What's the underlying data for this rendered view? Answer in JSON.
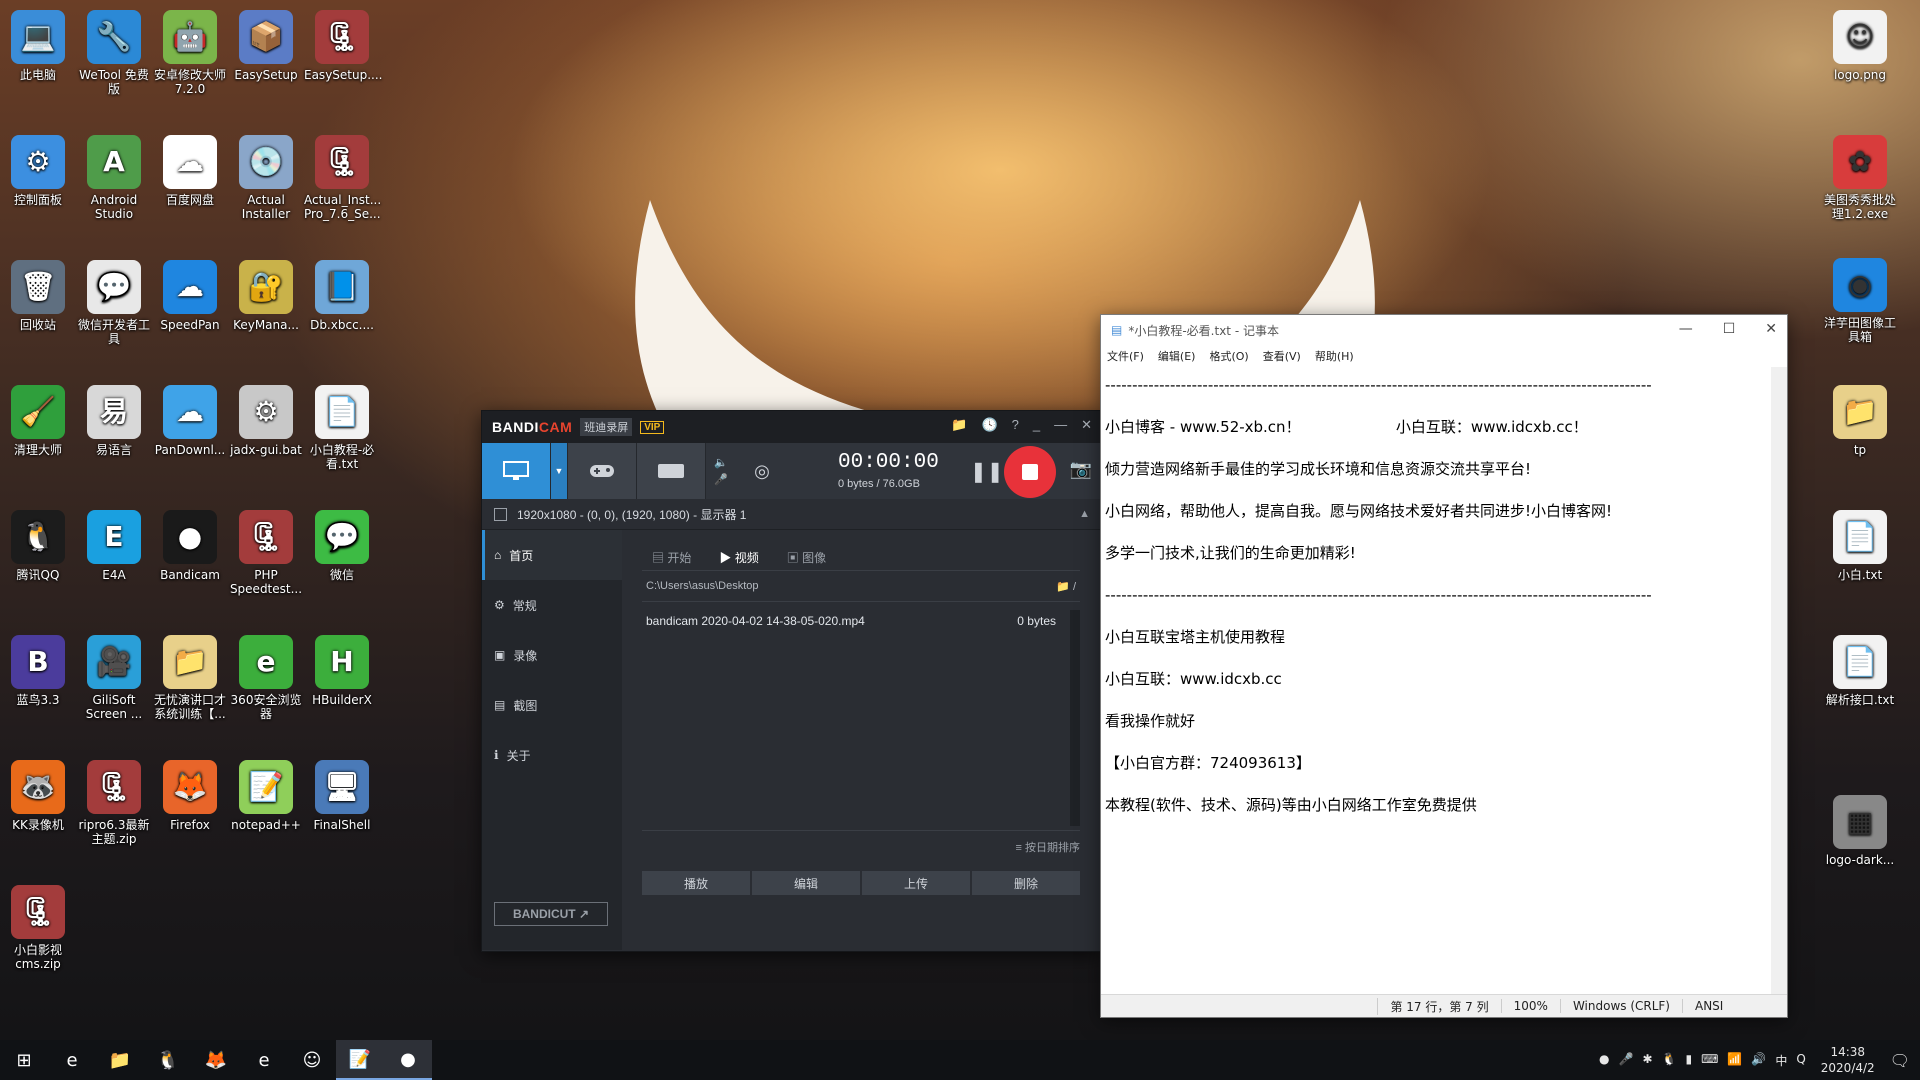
{
  "desktop": {
    "icons": [
      {
        "label": "此电脑",
        "color": "#3a8dd8",
        "glyph": "💻"
      },
      {
        "label": "WeTool 免费版",
        "color": "#2b89d6",
        "glyph": "🔧"
      },
      {
        "label": "安卓修改大师7.2.0",
        "color": "#7bb54a",
        "glyph": "🤖"
      },
      {
        "label": "EasySetup",
        "color": "#5b7cc6",
        "glyph": "📦"
      },
      {
        "label": "EasySetup....",
        "color": "#a33c3c",
        "glyph": "🗜"
      },
      {
        "label": "控制面板",
        "color": "#3c8fe0",
        "glyph": "⚙"
      },
      {
        "label": "Android Studio",
        "color": "#4f9c4a",
        "glyph": "A"
      },
      {
        "label": "百度网盘",
        "color": "#ffffff",
        "glyph": "☁"
      },
      {
        "label": "Actual Installer",
        "color": "#8aa6c9",
        "glyph": "💿"
      },
      {
        "label": "Actual_Inst... Pro_7.6_Se...",
        "color": "#a33c3c",
        "glyph": "🗜"
      },
      {
        "label": "回收站",
        "color": "#5f6f80",
        "glyph": "🗑"
      },
      {
        "label": "微信开发者工具",
        "color": "#e8e8e8",
        "glyph": "💬"
      },
      {
        "label": "SpeedPan",
        "color": "#1f86e0",
        "glyph": "☁"
      },
      {
        "label": "KeyMana...",
        "color": "#c9b24a",
        "glyph": "🔐"
      },
      {
        "label": "Db.xbcc....",
        "color": "#6fa7d8",
        "glyph": "📘"
      },
      {
        "label": "清理大师",
        "color": "#2f9f3c",
        "glyph": "🧹"
      },
      {
        "label": "易语言",
        "color": "#d8d8d8",
        "glyph": "易"
      },
      {
        "label": "PanDownl...",
        "color": "#3fa3e8",
        "glyph": "☁"
      },
      {
        "label": "jadx-gui.bat",
        "color": "#c8c8c8",
        "glyph": "⚙"
      },
      {
        "label": "小白教程-必看.txt",
        "color": "#f2f2f2",
        "glyph": "📄"
      },
      {
        "label": "腾讯QQ",
        "color": "#1c1c1c",
        "glyph": "🐧"
      },
      {
        "label": "E4A",
        "color": "#1aa0e0",
        "glyph": "E"
      },
      {
        "label": "Bandicam",
        "color": "#1a1a1a",
        "glyph": "●"
      },
      {
        "label": "PHP Speedtest...",
        "color": "#a33c3c",
        "glyph": "🗜"
      },
      {
        "label": "微信",
        "color": "#3dbb44",
        "glyph": "💬"
      },
      {
        "label": "蓝鸟3.3",
        "color": "#4b3c9c",
        "glyph": "B"
      },
      {
        "label": "GiliSoft Screen ...",
        "color": "#2a9fd8",
        "glyph": "🎥"
      },
      {
        "label": "无忧演讲口才系统训练【...",
        "color": "#e8d08a",
        "glyph": "📁"
      },
      {
        "label": "360安全浏览器",
        "color": "#3cae3c",
        "glyph": "e"
      },
      {
        "label": "HBuilderX",
        "color": "#3cae3c",
        "glyph": "H"
      },
      {
        "label": "KK录像机",
        "color": "#e86a1a",
        "glyph": "🦝"
      },
      {
        "label": "ripro6.3最新主题.zip",
        "color": "#a33c3c",
        "glyph": "🗜"
      },
      {
        "label": "Firefox",
        "color": "#e8652a",
        "glyph": "🦊"
      },
      {
        "label": "notepad++",
        "color": "#8fcf5a",
        "glyph": "📝"
      },
      {
        "label": "FinalShell",
        "color": "#4a7ab8",
        "glyph": "🖥"
      },
      {
        "label": "小白影视cms.zip",
        "color": "#a33c3c",
        "glyph": "🗜"
      }
    ],
    "right_icons": [
      {
        "label": "logo.png",
        "color": "#f2f2f2",
        "glyph": "☺"
      },
      {
        "label": "美图秀秀批处理1.2.exe",
        "color": "#d83c3c",
        "glyph": "✿"
      },
      {
        "label": "洋芋田图像工具箱",
        "color": "#1f86e0",
        "glyph": "◉"
      },
      {
        "label": "tp",
        "color": "#e8d08a",
        "glyph": "📁"
      },
      {
        "label": "小白.txt",
        "color": "#f2f2f2",
        "glyph": "📄"
      },
      {
        "label": "解析接口.txt",
        "color": "#f2f2f2",
        "glyph": "📄"
      },
      {
        "label": "logo-dark...",
        "color": "#888888",
        "glyph": "▦"
      }
    ]
  },
  "bandicam": {
    "brand_a": "BANDI",
    "brand_b": "CAM",
    "subtitle": "班迪录屏",
    "vip": "VIP",
    "title_icons": [
      "📁",
      "🕓",
      "?",
      "_",
      "—",
      "✕"
    ],
    "timer": "00:00:00",
    "size": "0 bytes / 76.0GB",
    "target": "1920x1080 - (0, 0), (1920, 1080) - 显示器 1",
    "sidebar": [
      {
        "label": "首页",
        "icon": "⌂"
      },
      {
        "label": "常规",
        "icon": "⚙"
      },
      {
        "label": "录像",
        "icon": "▣"
      },
      {
        "label": "截图",
        "icon": "▤"
      },
      {
        "label": "关于",
        "icon": "ℹ"
      }
    ],
    "bandicut": "BANDICUT ↗",
    "tabs": [
      "开始",
      "视频",
      "图像"
    ],
    "path": "C:\\Users\\asus\\Desktop",
    "file_name": "bandicam 2020-04-02 14-38-05-020.mp4",
    "file_size": "0 bytes",
    "sort_label": "≡ 按日期排序",
    "actions": [
      "播放",
      "编辑",
      "上传",
      "删除"
    ]
  },
  "notepad": {
    "title": "*小白教程-必看.txt - 记事本",
    "menu": [
      "文件(F)",
      "编辑(E)",
      "格式(O)",
      "查看(V)",
      "帮助(H)"
    ],
    "lines": [
      "-----------------------------------------------------------------------------------------------------",
      "小白博客 - www.52-xb.cn！                    小白互联：www.idcxb.cc！",
      "倾力营造网络新手最佳的学习成长环境和信息资源交流共享平台!",
      "小白网络，帮助他人，提高自我。愿与网络技术爱好者共同进步!小白博客网!",
      "多学一门技术,让我们的生命更加精彩!",
      "-----------------------------------------------------------------------------------------------------",
      "小白互联宝塔主机使用教程",
      "小白互联：www.idcxb.cc",
      "看我操作就好",
      "",
      "【小白官方群：724093613】",
      "本教程(软件、技术、源码)等由小白网络工作室免费提供"
    ],
    "status": {
      "pos": "第 17 行，第 7 列",
      "zoom": "100%",
      "eol": "Windows (CRLF)",
      "enc": "ANSI"
    }
  },
  "taskbar": {
    "items": [
      "⊞",
      "e",
      "📁",
      "🐧",
      "🦊",
      "e",
      "☺",
      "📝",
      "●"
    ],
    "tray_icons": [
      "●",
      "🎤",
      "✱",
      "🐧",
      "▮",
      "⌨",
      "📶",
      "🔊",
      "中",
      "Q"
    ],
    "time": "14:38",
    "date": "2020/4/2",
    "notify": "🗨"
  }
}
